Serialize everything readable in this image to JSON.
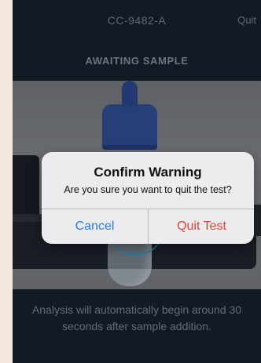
{
  "header": {
    "device_id": "CC-9482-A",
    "quit_label": "Quit"
  },
  "status": {
    "title": "AWAITING SAMPLE"
  },
  "dialog": {
    "title": "Confirm Warning",
    "message": "Are you sure you want to quit the test?",
    "cancel_label": "Cancel",
    "quit_label": "Quit Test"
  },
  "instructions": {
    "text": "Analysis will automatically begin around 30 seconds after sample addition."
  },
  "colors": {
    "background": "#141a24",
    "cancel": "#2c7be5",
    "destructive": "#e0433b",
    "progress_arc": "#3aa3d8"
  }
}
